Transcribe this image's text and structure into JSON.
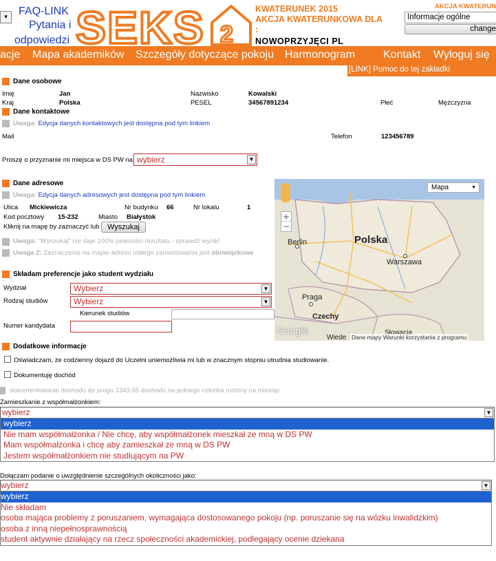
{
  "header": {
    "lang_select": "▾",
    "faq_line1": "FAQ-LINK",
    "faq_line2": "Pytania i",
    "faq_line3": "odpowiedzi",
    "logo_text": "SEKS",
    "logo_num": "2",
    "kwat_line1": "KWATERUNEK 2015",
    "kwat_line2": "AKCJA KWATERUNKOWA DLA",
    "kwat_line3": ":",
    "kwat_line4": "NOWOPRZYJĘCI PL",
    "akcja_right": "AKCJA KWATERUNKOWA",
    "info_select": "Informacje ogólne",
    "change_button": "change"
  },
  "nav": {
    "items": [
      "acje",
      "Mapa akademików",
      "Szczegóły dotyczące pokoju",
      "Harmonogram",
      "Kontakt",
      "Wyloguj się"
    ],
    "help": "[LINK] Pomoc do tej zakładki"
  },
  "personal": {
    "title": "Dane osobowe",
    "imie_label": "Imię",
    "imie": "Jan",
    "nazwisko_label": "Nazwisko",
    "nazwisko": "Kowalski",
    "kraj_label": "Kraj",
    "kraj": "Polska",
    "pesel_label": "PESEL",
    "pesel": "34567891234",
    "plec_label": "Płeć",
    "plec": "Mężczyzna"
  },
  "contact": {
    "title": "Dane kontaktowe",
    "warn_prefix": "Uwaga:",
    "warn_text": "Edycja danych kontaktowych jest dostępna pod tym linkiem",
    "mail_label": "Mail",
    "telefon_label": "Telefon",
    "telefon": "123456789"
  },
  "request": {
    "label": "Proszę o przyznanie mi miejsca w DS PW na",
    "value": "wybierz"
  },
  "address": {
    "title": "Dane adresowe",
    "warn_prefix": "Uwaga:",
    "warn_text": "Edycja danych adresowych jest dostępna pod tym linkiem",
    "ulica_label": "Ulica",
    "ulica": "Mickiewicza",
    "budynek_label": "Nr budynku",
    "budynek": "66",
    "lokal_label": "Nr lokalu",
    "lokal": "1",
    "kod_label": "Kod pocztowy",
    "kod": "15-232",
    "miasto_label": "Miasto",
    "miasto": "Białystok",
    "click_text": "Kliknij na mapę by zaznaczyć lub",
    "search_button": "Wyszukaj",
    "warn2_prefix": "Uwaga:",
    "warn2_text": "\"Wyszukaj\" nie daje 100% pewności rezultatu - sprawdź wynik!",
    "warn3_prefix": "Uwaga 2:",
    "warn3_text": "Zaznaczenie na mapie adresu stałego zameldowania jest",
    "warn3_bold": "obowiązkowe"
  },
  "map": {
    "type_select": "Mapa",
    "plus": "+",
    "minus": "−",
    "labels": {
      "polska": "Polska",
      "berlin": "Berlin",
      "warszawa": "Warszawa",
      "praga": "Praga",
      "czechy": "Czechy",
      "slowacja": "Słowacja",
      "wiede": "Wiede"
    },
    "google": "Google",
    "footer": "Dane mapy  Warunki korzystania z programu"
  },
  "preferences": {
    "title": "Składam preferencje jako student wydziału",
    "wydzial_label": "Wydział",
    "wydzial": "Wybierz",
    "rodzaj_label": "Rodzaj studiów",
    "rodzaj": "Wybierz",
    "kierunek_label": "Kierunek studiów",
    "numer_label": "Numer kandydata"
  },
  "extra": {
    "title": "Dodatkowe informacje",
    "cb1": "Oświadczam, że codzienny dojazd do Uczelni uniemożliwia mi lub w znacznym stopniu utrudnia studiowanie.",
    "cb2": "Dokumentuję dochód",
    "income_text": "dokumentowanie dochodu do progu 1343.55 dochodu na jednego członka rodziny na miesiąc",
    "spouse_label": "Zamieszkanie z współmałżonkiem:",
    "spouse_value": "wybierz",
    "spouse_options": [
      "wybierz",
      "Nie mam współmałżonka / Nie chcę, aby współmałżonek mieszkał ze mną w DS PW",
      "Mam współmałżonka i chcę aby zamieszkał ze mną w DS PW",
      "Jestem współmałżonkiem nie studiującym na PW"
    ],
    "special_label": "Dołączam podanie o uwzględnienie szczególnych okoliczności jako:",
    "special_value": "wybierz",
    "special_options": [
      "wybierz",
      "Nie składam",
      "osoba mająca problemy z poruszaniem, wymagająca dostosowanego pokoju (np. poruszanie się na wózku inwalidzkim)",
      "osoba z inną niepełnosprawnością",
      "student aktywnie działający na rzecz społeczności akademickiej, podlegający ocenie dziekana"
    ]
  }
}
